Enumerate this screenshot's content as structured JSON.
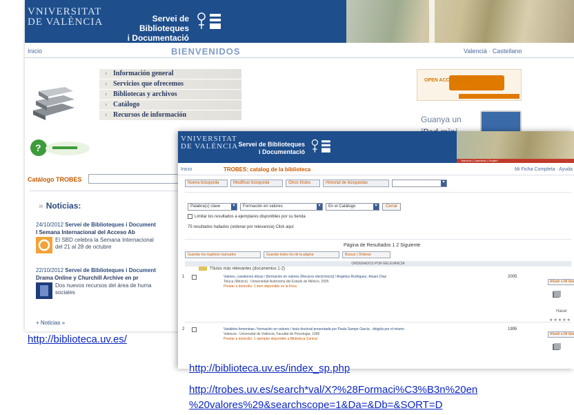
{
  "back_window": {
    "brand": {
      "university_line1": "VNIVERSITAT",
      "university_line2": "DE VALÈNCIA",
      "service_line1": "Servei de Biblioteques",
      "service_line2": "i Documentació"
    },
    "nav": {
      "home": "Inicio",
      "heading": "BIENVENIDOS",
      "languages": "Valencià · Castellano"
    },
    "menu": [
      "Información general",
      "Servicios que ofrecemos",
      "Bibliotecas y archivos",
      "Catálogo",
      "Recursos de información"
    ],
    "promo": {
      "open_access_label": "OPEN ACCESS WEEK",
      "win_text": "Guanya un",
      "prize": "iPad mini"
    },
    "catalog_label": "Catálogo TROBES",
    "news_heading": "Noticias:",
    "news": [
      {
        "date": "24/10/2012",
        "source": "Servei de Biblioteques i Document",
        "title": "I Semana Internacional del Acceso Ab",
        "summary": "El SBD celebra la Semana Internacional",
        "summary2": "del 21 al 28 de octubre"
      },
      {
        "date": "22/10/2012",
        "source": "Servei de Biblioteques i Document",
        "title": "Drama Online y Churchill Archive en pr",
        "summary": "Dos nuevos recursos del área de huma",
        "summary2": "sociales"
      }
    ],
    "more_news": "+ Noticias »"
  },
  "front_window": {
    "brand": {
      "university_line1": "VNIVERSITAT",
      "university_line2": "DE VALÈNCIA",
      "service_line1": "Servei de Biblioteques",
      "service_line2": "i Documentació"
    },
    "nav": {
      "home": "Inicio",
      "title": "TROBES: catalog de la biblioteca",
      "top_right": "Mi Ficha Completa · Ayuda",
      "languages": "Valencià | Castellano | English"
    },
    "menu_buttons": [
      "Nueva búsqueda",
      "Modificar búsqueda",
      "Otros títulos",
      "Historial de búsquedas"
    ],
    "search": {
      "field": "Palabra(s) clave",
      "query": "Formación en valores",
      "scope": "En el Catálogo",
      "submit": "Cerrar",
      "limit_text": "Limitar los resultados a ejemplares disponibles por su tienda",
      "count_text": "75 resultados hallados (ordenar por relevancia)  Click aquí"
    },
    "pagination": "Página de Resultados  1 2 Siguiente",
    "action_buttons": [
      "Guardar los registros marcados",
      "Guardar todos los de la página",
      "Buscar  |  Ordenar"
    ],
    "ordering": "ORDENADOS POR RELEVANCIA",
    "relevance_note": "Títulos más relevantes (documentos 1-2)",
    "results": [
      {
        "num": "1",
        "line1": "Valores, cuestiones éticas / [formación en valores (Recurso electrónico)] / Angélica Rodríguez, Álvaro Díaz",
        "line2": "Toluca (México) : Universidad Autónoma del Estado de México, 2005",
        "line3": "Prestar a domicilio: 1 item disponible en la línea",
        "year": "2005",
        "side": "Añadir a Mi lista"
      },
      {
        "num": "2",
        "line1": "Variables femeninas / formación en valores / tesis doctoral presentada por Paula Sampe Garcia ; dirigida por el mismo",
        "line2": "Valencia : Universitat de València, Facultat de Psicologia, 1995",
        "line3": "Prestar a domicilio: 1 ejemplar disponible a Biblioteca Central",
        "year": "1995",
        "side": "Añadir a Mi lista"
      }
    ],
    "rating_hint": "Hacer"
  },
  "captions": {
    "url1": "http://biblioteca.uv.es/",
    "url2": "http://biblioteca.uv.es/index_sp.php",
    "url3": "http://trobes.uv.es/search*val/X?%28Formaci%C3%B3n%20en",
    "url4": "%20valores%29&searchscope=1&Da=&Db=&SORT=D"
  },
  "colors": {
    "banner_blue": "#1e4e8c",
    "link_blue": "#0b26c2",
    "accent_orange": "#c65a00"
  }
}
